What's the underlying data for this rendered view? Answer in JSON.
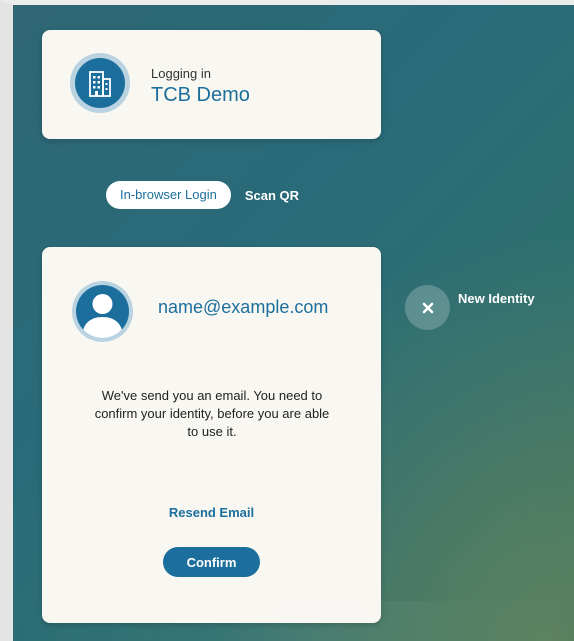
{
  "login": {
    "label": "Logging in",
    "org_name": "TCB Demo",
    "icon": "building-icon"
  },
  "tabs": [
    {
      "label": "In-browser Login",
      "active": true
    },
    {
      "label": "Scan QR",
      "active": false
    }
  ],
  "identity": {
    "email": "name@example.com",
    "avatar_icon": "user-icon",
    "message": "We've send you an email. You need to confirm your identity, before you are able to use it.",
    "resend_label": "Resend Email",
    "confirm_label": "Confirm"
  },
  "new_identity": {
    "label": "New Identity",
    "icon": "close-icon"
  },
  "colors": {
    "accent": "#1c6f9c",
    "card": "#f8f7f2",
    "background": "#2d6a77"
  }
}
